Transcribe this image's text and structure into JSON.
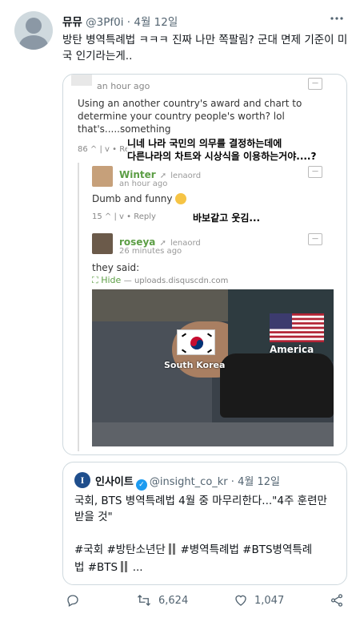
{
  "tweet": {
    "display_name": "뮤뮤",
    "handle": "@3Pf0i",
    "separator": "·",
    "date": "4월 12일",
    "text": "방탄 병역특례법 ㅋㅋㅋ 진짜 나만 쪽팔림? 군대 면제 기준이 미국 인기라는게..",
    "more_icon": "more-icon"
  },
  "screenshot": {
    "top_time": "an hour ago",
    "comment1_text": "Using an another country's award and chart to determine your country people's worth? lol that's.....something",
    "comment1_votes": "86",
    "comment1_reply": "Reply",
    "overlay1_line1": "니네 나라 국민의 의무를 결정하는데에",
    "overlay1_line2": "다른나라의 차트와 시상식을 이용하는거야....?",
    "c2_user": "Winter",
    "c2_replyto": "lenaord",
    "c2_time": "an hour ago",
    "c2_text": "Dumb and funny",
    "c2_votes": "15",
    "c2_reply": "Reply",
    "overlay2": "바보같고 웃김...",
    "c3_user": "roseya",
    "c3_replyto": "lenaord",
    "c3_time": "26 minutes ago",
    "c3_text": "they said:",
    "hide_label": "Hide",
    "hide_url": "— uploads.disquscdn.com",
    "meme_label_left": "South Korea",
    "meme_label_right": "America",
    "collapse": "—"
  },
  "quote": {
    "logo_letter": "I",
    "name": "인사이트",
    "handle": "@insight_co_kr",
    "separator": "·",
    "date": "4월 12일",
    "text": "국회, BTS 병역특례법 4월 중 마무리한다...\"4주 훈련만 받을 것\"",
    "tags_line1a": "#국회 #방탄소년단",
    "tags_line1b": "#병역특례법 #BTS병역특례",
    "tags_line2a": "법 #BTS",
    "tags_line2b": "..."
  },
  "actions": {
    "retweets": "6,624",
    "likes": "1,047"
  },
  "colors": {
    "text": "#0f1419",
    "muted": "#536471",
    "border": "#cfd9de",
    "verified": "#1d9bf0",
    "disqus_green": "#5c9e45"
  }
}
